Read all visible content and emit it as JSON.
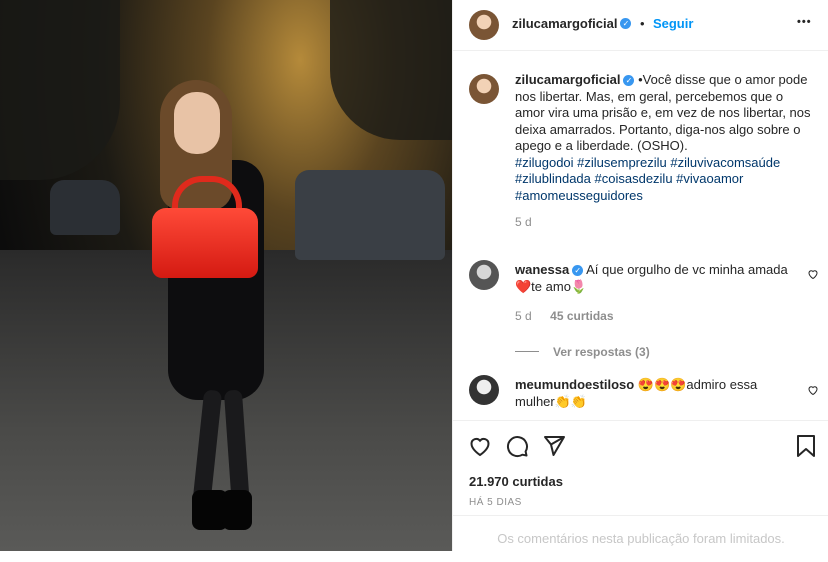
{
  "post": {
    "username": "zilucamargoficial",
    "follow_label": "Seguir",
    "more_label": "•••",
    "caption_text": "•Você disse que o amor pode nos libertar. Mas, em geral, percebemos que o amor vira uma prisão e, em vez de nos libertar, nos deixa amarrados. Portanto, diga-nos algo sobre o apego e a liberdade. (OSHO).",
    "hashtags": "#zilugodoi #zilusemprezilu #ziluvivacomsaúde #zilublindada #coisasdezilu #vivaoamor #amomeusseguidores",
    "caption_time": "5 d"
  },
  "comments": [
    {
      "username": "wanessa",
      "text": "Aí que orgulho de vc minha amada❤️te amo🌷",
      "time": "5 d",
      "likes": "45 curtidas",
      "view_replies": "Ver respostas (3)"
    },
    {
      "username": "meumundoestiloso",
      "text": "😍😍😍admiro essa mulher👏👏"
    }
  ],
  "footer": {
    "likes": "21.970 curtidas",
    "date": "HÁ 5 DIAS",
    "limited_notice": "Os comentários nesta publicação foram limitados."
  },
  "icons": [
    "verified-badge-icon",
    "heart-icon",
    "comment-icon",
    "share-icon",
    "bookmark-icon",
    "more-options-icon"
  ],
  "colors": {
    "accent_blue": "#0095f6",
    "verified_blue": "#3897f0",
    "text": "#262626",
    "muted": "#8e8e8e"
  }
}
